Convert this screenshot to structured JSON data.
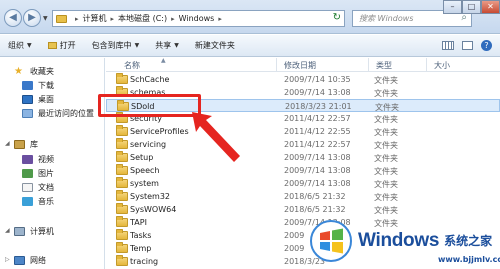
{
  "window": {
    "breadcrumbs": [
      "计算机",
      "本地磁盘 (C:)",
      "Windows"
    ],
    "search_placeholder": "搜索 Windows"
  },
  "toolbar": {
    "organize": "组织",
    "open": "打开",
    "include_in_library": "包含到库中",
    "share": "共享",
    "new_folder": "新建文件夹"
  },
  "sidebar": {
    "favorites": "收藏夹",
    "downloads": "下载",
    "desktop": "桌面",
    "recent": "最近访问的位置",
    "libraries": "库",
    "videos": "视频",
    "pictures": "图片",
    "documents": "文档",
    "music": "音乐",
    "computer": "计算机",
    "network": "网络"
  },
  "columns": {
    "name": "名称",
    "date": "修改日期",
    "type": "类型",
    "size": "大小"
  },
  "files": [
    {
      "name": "SchCache",
      "date": "2009/7/14 10:35",
      "type": "文件夹"
    },
    {
      "name": "schemas",
      "date": "2009/7/14 13:08",
      "type": "文件夹"
    },
    {
      "name": "SDold",
      "date": "2018/3/23 21:01",
      "type": "文件夹"
    },
    {
      "name": "security",
      "date": "2011/4/12 22:57",
      "type": "文件夹"
    },
    {
      "name": "ServiceProfiles",
      "date": "2011/4/12 22:55",
      "type": "文件夹"
    },
    {
      "name": "servicing",
      "date": "2011/4/12 22:57",
      "type": "文件夹"
    },
    {
      "name": "Setup",
      "date": "2009/7/14 13:08",
      "type": "文件夹"
    },
    {
      "name": "Speech",
      "date": "2009/7/14 13:08",
      "type": "文件夹"
    },
    {
      "name": "system",
      "date": "2009/7/14 13:08",
      "type": "文件夹"
    },
    {
      "name": "System32",
      "date": "2018/6/5 21:32",
      "type": "文件夹"
    },
    {
      "name": "SysWOW64",
      "date": "2018/6/5 21:32",
      "type": "文件夹"
    },
    {
      "name": "TAPI",
      "date": "2009/7/14 13:08",
      "type": "文件夹"
    },
    {
      "name": "Tasks",
      "date": "2009",
      "type": ""
    },
    {
      "name": "Temp",
      "date": "2009",
      "type": ""
    },
    {
      "name": "tracing",
      "date": "2018/3/23",
      "type": ""
    }
  ],
  "watermark": {
    "brand": "Windows",
    "sub": "系统之家",
    "url": "www.bjjmlv.com"
  },
  "colors": {
    "highlight": "#e52520",
    "selection": "#dcebfb",
    "brand": "#1b4e9c"
  }
}
